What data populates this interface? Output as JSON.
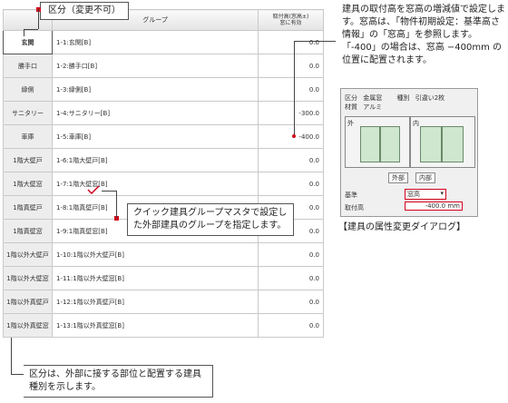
{
  "table": {
    "headers": {
      "kubun": "",
      "group": "グループ",
      "value_line1": "取付高(窓高±)",
      "value_line2": "窓に有効"
    },
    "rows": [
      {
        "kubun": "玄関",
        "group": "1-1:玄関[B]",
        "value": "0.0"
      },
      {
        "kubun": "勝手口",
        "group": "1-2:勝手口[B]",
        "value": "0.0"
      },
      {
        "kubun": "縁側",
        "group": "1-3:縁側[B]",
        "value": "0.0"
      },
      {
        "kubun": "サニタリー",
        "group": "1-4:サニタリー[B]",
        "value": "-300.0"
      },
      {
        "kubun": "車庫",
        "group": "1-5:車庫[B]",
        "value": "-400.0"
      },
      {
        "kubun": "1階大壁戸",
        "group": "1-6:1階大壁戸[B]",
        "value": "0.0"
      },
      {
        "kubun": "1階大壁窓",
        "group": "1-7:1階大壁窓[B]",
        "value": "0.0"
      },
      {
        "kubun": "1階真壁戸",
        "group": "1-8:1階真壁戸[B]",
        "value": "0.0"
      },
      {
        "kubun": "1階真壁窓",
        "group": "1-9:1階真壁窓[B]",
        "value": "0.0"
      },
      {
        "kubun": "1階以外大壁戸",
        "group": "1-10:1階以外大壁戸[B]",
        "value": "0.0"
      },
      {
        "kubun": "1階以外大壁窓",
        "group": "1-11:1階以外大壁窓[B]",
        "value": "0.0"
      },
      {
        "kubun": "1階以外真壁戸",
        "group": "1-12:1階以外真壁戸[B]",
        "value": "0.0"
      },
      {
        "kubun": "1階以外真壁窓",
        "group": "1-13:1階以外真壁窓[B]",
        "value": "0.0"
      }
    ]
  },
  "callouts": {
    "kubun_fixed": "区分（変更不可）",
    "group_note": "クイック建具グループマスタで設定した外部建具のグループを指定します。",
    "kubun_note": "区分は、外部に接する部位と配置する建具種別を示します。",
    "side_note": "建具の取付高を窓高の増減値で設定します。窓高は、「物件初期設定：基準高さ情報」の「窓高」を参照します。「-400」の場合は、窓高 −400mm の位置に配置されます。"
  },
  "dialog": {
    "kubun_label": "区分",
    "kubun_value": "金属窓",
    "type_label": "種別",
    "type_value": "引違い2枚",
    "material_label": "材質",
    "material_value": "アルミ",
    "outside_label": "外",
    "inside_label": "内",
    "tab_outside": "外部",
    "tab_inside": "内部",
    "base_label": "基準",
    "base_value": "窓高",
    "height_label": "取付高",
    "height_value": "-400.0 mm"
  },
  "caption": "【建具の属性変更ダイアログ】"
}
